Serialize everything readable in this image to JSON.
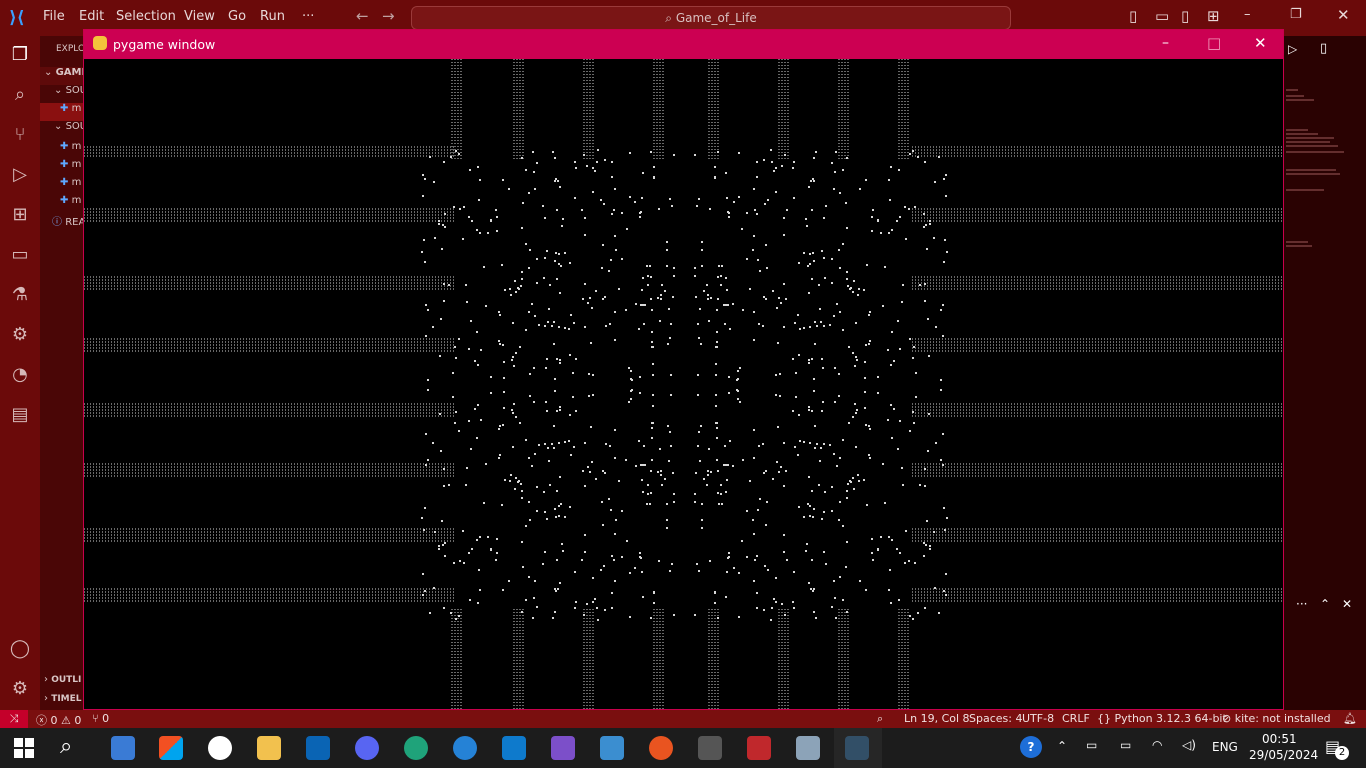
{
  "vscode": {
    "menu": [
      "File",
      "Edit",
      "Selection",
      "View",
      "Go",
      "Run",
      "···"
    ],
    "search_text": "Game_of_Life",
    "explorer_label": "EXPLO",
    "tree": [
      {
        "label": "GAME"
      },
      {
        "label": "SOU"
      },
      {
        "label": "m"
      },
      {
        "label": "SOU"
      },
      {
        "label": "m"
      },
      {
        "label": "m"
      },
      {
        "label": "m"
      },
      {
        "label": "m"
      },
      {
        "label": "REA"
      }
    ],
    "outline_label": "OUTLI",
    "timeline_label": "TIMEL"
  },
  "pygame": {
    "title": "pygame window",
    "min": "–",
    "max": "□",
    "close": "✕"
  },
  "status": {
    "errors": "0",
    "warnings": "0",
    "ports": "0",
    "position": "Ln 19, Col 8",
    "spaces": "Spaces: 4",
    "encoding": "UTF-8",
    "eol": "CRLF",
    "language": "Python",
    "interpreter": "3.12.3 64-bit",
    "kite": "kite: not installed"
  },
  "taskbar": {
    "lang": "ENG",
    "time": "00:51",
    "date": "29/05/2024",
    "notif_count": "2"
  },
  "colors": {
    "titlebar": "#6b0a0a",
    "pygame_title": "#cc0052",
    "statusbar": "#7a0f0f"
  }
}
